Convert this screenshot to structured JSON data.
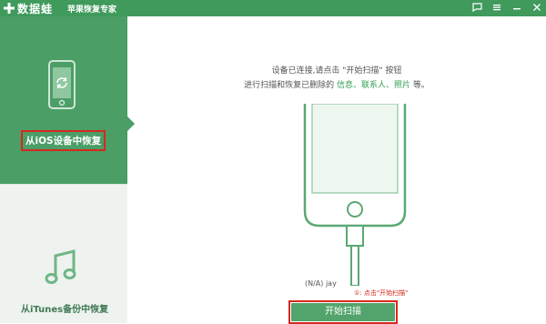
{
  "app": {
    "brand": "数据蛙",
    "subtitle": "苹果恢复专家"
  },
  "sidebar": {
    "items": [
      {
        "label": "从iOS设备中恢复"
      },
      {
        "label": "从iTunes备份中恢复"
      }
    ]
  },
  "main": {
    "message_line1": "设备已连接,请点击 \"开始扫描\" 按钮",
    "message_line2_prefix": "进行扫描和恢复已删除的",
    "message_line2_items": "信息、联系人、照片",
    "message_line2_suffix": "等。",
    "device_name": "(N/A) jay",
    "hint": "①: 点击\"开始扫描\"",
    "scan_button": "开始扫描"
  },
  "colors": {
    "accent": "#4a9e66",
    "titlebar": "#3f9a5c",
    "highlight": "#d6281f"
  }
}
